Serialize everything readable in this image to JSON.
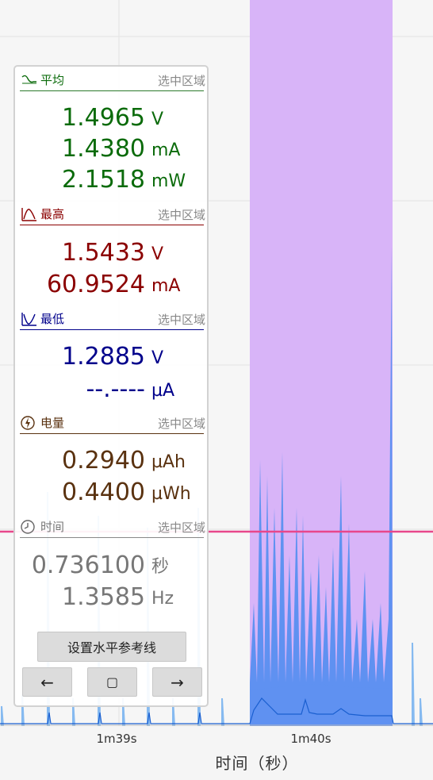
{
  "colors": {
    "selection": "#d8b4f8",
    "reference_line": "#e8478b",
    "waveform": "#4a8cf0",
    "avg": "#0b6b0b",
    "max": "#8b0000",
    "min": "#00008b",
    "energy": "#5a3210",
    "time": "#777777"
  },
  "axis": {
    "ticks": [
      "1m39s",
      "1m40s"
    ],
    "title": "时间（秒）"
  },
  "panel": {
    "average": {
      "icon": "average-wave-icon",
      "title": "平均",
      "scope": "选中区域",
      "rows": [
        {
          "value": "1.4965",
          "unit": "V"
        },
        {
          "value": "1.4380",
          "unit": "mA"
        },
        {
          "value": "2.1518",
          "unit": "mW"
        }
      ]
    },
    "max": {
      "icon": "peak-icon",
      "title": "最高",
      "scope": "选中区域",
      "rows": [
        {
          "value": "1.5433",
          "unit": "V"
        },
        {
          "value": "60.9524",
          "unit": "mA"
        }
      ]
    },
    "min": {
      "icon": "valley-icon",
      "title": "最低",
      "scope": "选中区域",
      "rows": [
        {
          "value": "1.2885",
          "unit": "V"
        },
        {
          "value": "--.----",
          "unit": "µA"
        }
      ]
    },
    "energy": {
      "icon": "lightning-icon",
      "title": "电量",
      "scope": "选中区域",
      "rows": [
        {
          "value": "0.2940",
          "unit": "µAh"
        },
        {
          "value": "0.4400",
          "unit": "µWh"
        }
      ]
    },
    "time": {
      "icon": "clock-icon",
      "title": "时间",
      "scope": "选中区域",
      "rows": [
        {
          "value": "0.736100",
          "unit": "秒"
        },
        {
          "value": "1.3585",
          "unit": "Hz"
        }
      ]
    },
    "buttons": {
      "set_reference": "设置水平参考线",
      "left": "←",
      "center": "▢",
      "right": "→"
    }
  }
}
